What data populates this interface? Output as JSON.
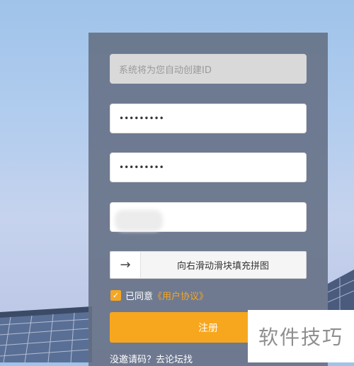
{
  "form": {
    "id_field": {
      "placeholder": "系统将为您自动创建ID"
    },
    "password": {
      "value": "•••••••••"
    },
    "confirm_password": {
      "value": "•••••••••"
    },
    "slider": {
      "arrow": "→",
      "text": "向右滑动滑块填充拼图"
    },
    "agree": {
      "checkmark": "✓",
      "text": "已同意",
      "link": "《用户协议》"
    },
    "register_label": "注册",
    "footer_link": "没邀请码？去论坛找"
  },
  "watermark": {
    "text": "软件技巧"
  },
  "colors": {
    "accent": "#f7a71e",
    "panel": "#667186",
    "link": "#f5a623"
  }
}
